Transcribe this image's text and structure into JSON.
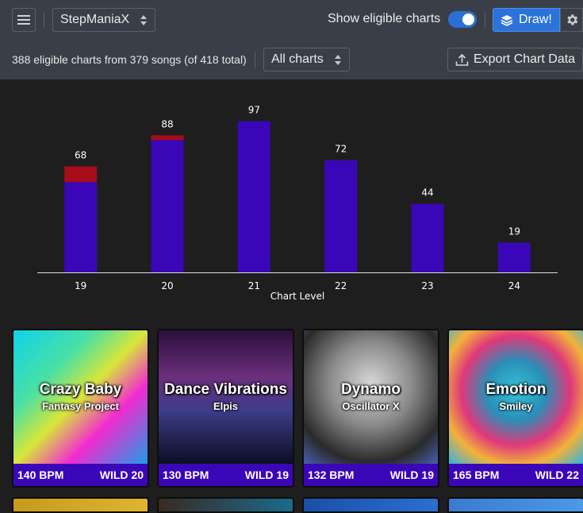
{
  "header": {
    "game_select": "StepManiaX",
    "toggle_label": "Show eligible charts",
    "toggle_on": true,
    "draw_label": "Draw!"
  },
  "toolbar": {
    "count_text": "388 eligible charts from 379 songs (of 418 total)",
    "filter_select": "All charts",
    "export_label": "Export Chart Data"
  },
  "chart_data": {
    "type": "bar",
    "xlabel": "Chart Level",
    "categories": [
      "19",
      "20",
      "21",
      "22",
      "23",
      "24"
    ],
    "totals": [
      68,
      88,
      97,
      72,
      44,
      19
    ],
    "series": [
      {
        "color": "#3a06b8",
        "values": [
          58,
          85,
          97,
          72,
          44,
          19
        ]
      },
      {
        "color": "#a80c18",
        "values": [
          10,
          3,
          0,
          0,
          0,
          0
        ]
      }
    ],
    "ylim": [
      0,
      105
    ],
    "grid": false
  },
  "cards": [
    {
      "title": "Crazy Baby",
      "artist": "Fantasy Project",
      "bpm": "140 BPM",
      "level": "WILD 20",
      "bg": "linear-gradient(135deg,#0fd3e8 0%,#49e0a4 30%,#d8e63a 50%,#f22ad0 70%,#1c9ee8 100%)"
    },
    {
      "title": "Dance Vibrations",
      "artist": "Elpis",
      "bpm": "130 BPM",
      "level": "WILD 19",
      "bg": "linear-gradient(180deg,#2a0f3a 0%,#6b2f7c 35%,#3d3c8a 60%,#0c0d22 100%)"
    },
    {
      "title": "Dynamo",
      "artist": "Oscillator X",
      "bpm": "132 BPM",
      "level": "WILD 19",
      "bg": "radial-gradient(circle at 50% 40%,#d8d8d8 0%,#8a8a8a 40%,#2a2a2a 75%,#4a5fb0 100%)"
    },
    {
      "title": "Emotion",
      "artist": "Smiley",
      "bpm": "165 BPM",
      "level": "WILD 22",
      "bg": "radial-gradient(circle at 50% 45%,#37c2d8 0%,#2a8fb8 30%,#e0387a 55%,#f2b23a 75%,#2fb3e0 100%)"
    }
  ],
  "peek_cards": [
    {
      "bg": "linear-gradient(90deg,#c89a1c,#e0b330)"
    },
    {
      "bg": "linear-gradient(90deg,#3a2a24,#1a6a8a)"
    },
    {
      "bg": "linear-gradient(90deg,#1a4fa8,#2a6fd0)"
    },
    {
      "bg": "linear-gradient(90deg,#3a7ad0,#4a9ae8)"
    }
  ]
}
